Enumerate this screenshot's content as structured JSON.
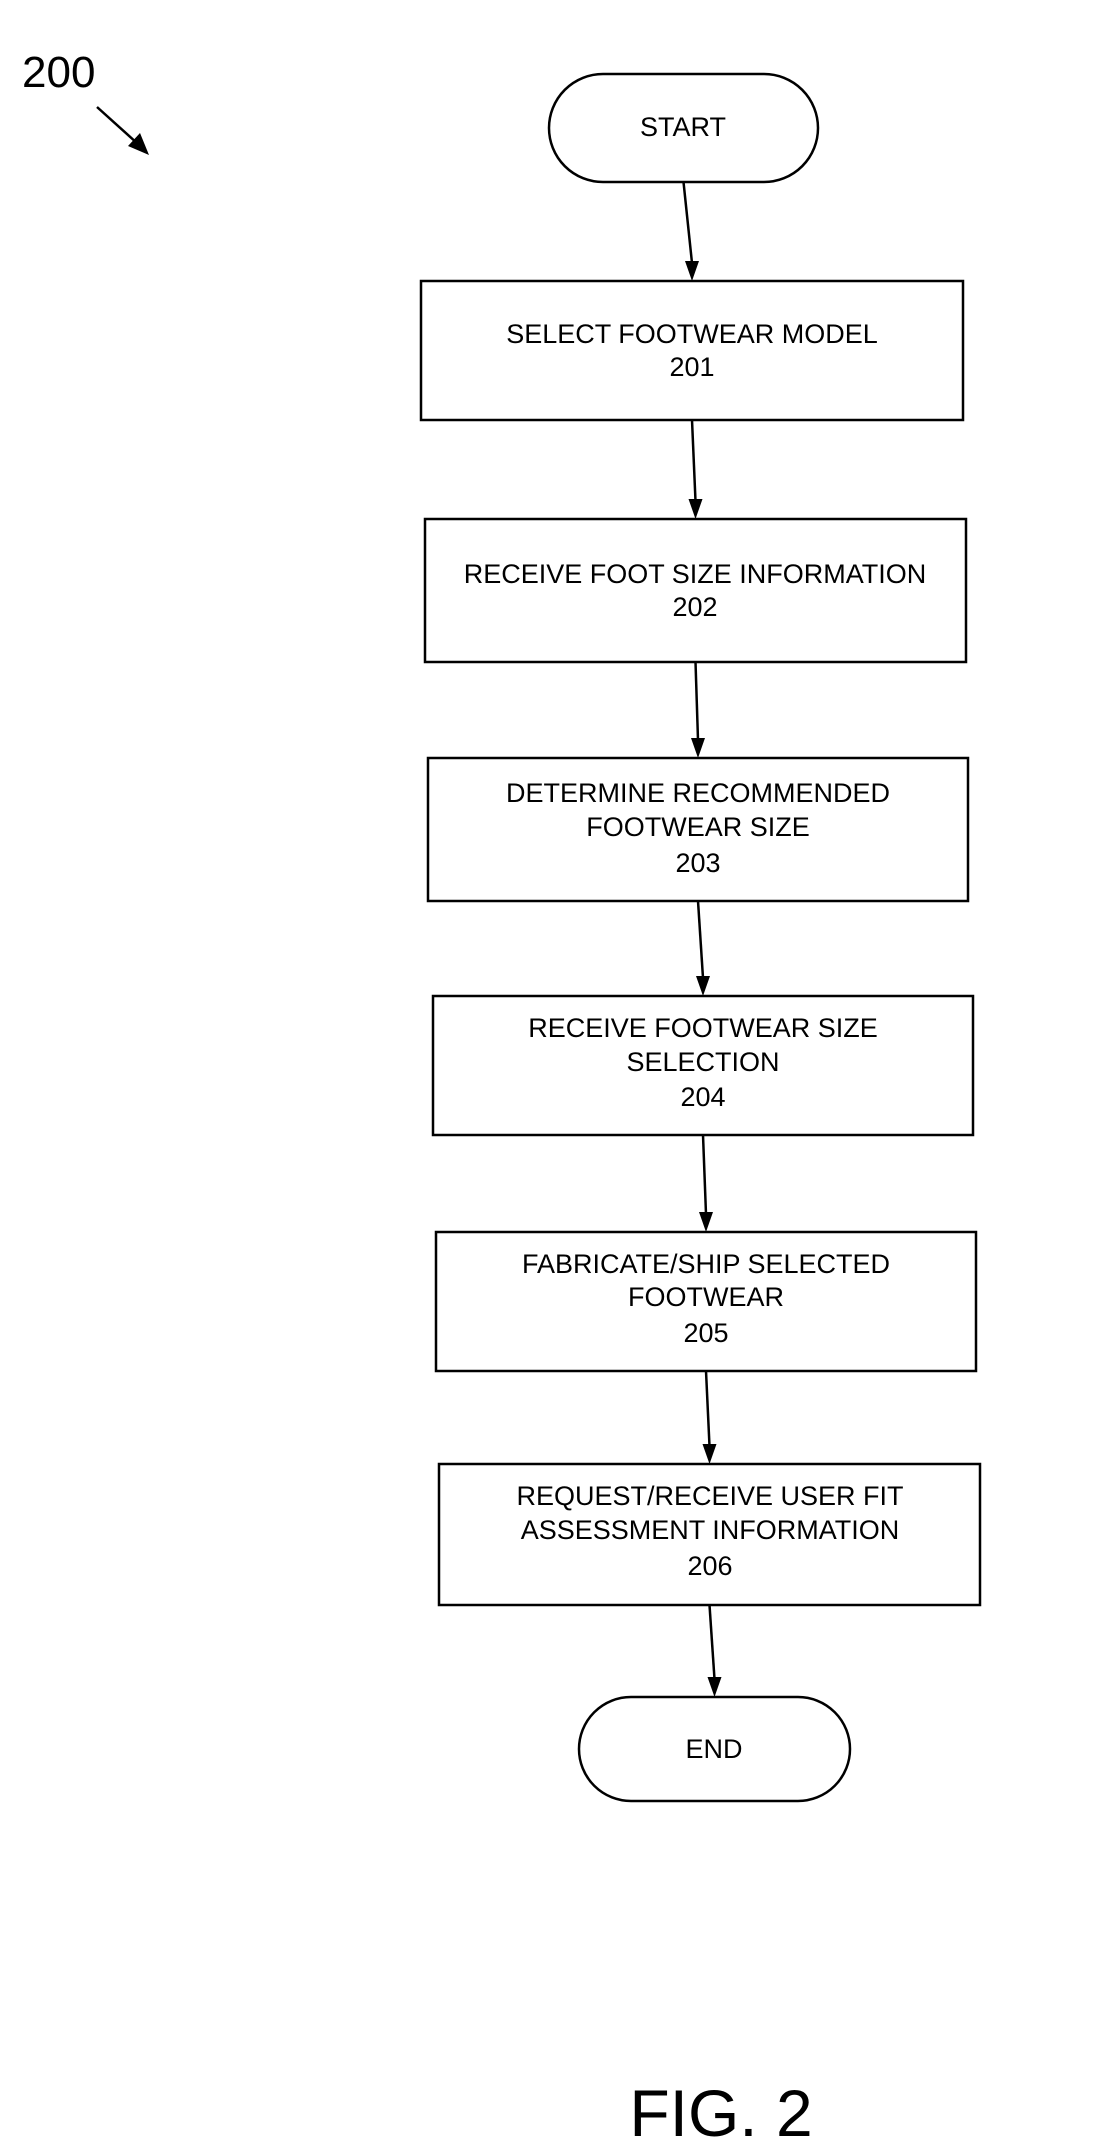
{
  "figure": {
    "reference_numeral": "200",
    "caption": "FIG. 2",
    "ink_color": "#000000",
    "background_color": "#ffffff"
  },
  "flow": {
    "start": {
      "label": "START"
    },
    "steps": [
      {
        "id": "201",
        "lines": [
          "SELECT FOOTWEAR MODEL"
        ],
        "number": "201"
      },
      {
        "id": "202",
        "lines": [
          "RECEIVE FOOT SIZE INFORMATION"
        ],
        "number": "202"
      },
      {
        "id": "203",
        "lines": [
          "DETERMINE RECOMMENDED",
          "FOOTWEAR SIZE"
        ],
        "number": "203"
      },
      {
        "id": "204",
        "lines": [
          "RECEIVE FOOTWEAR SIZE",
          "SELECTION"
        ],
        "number": "204"
      },
      {
        "id": "205",
        "lines": [
          "FABRICATE/SHIP SELECTED",
          "FOOTWEAR"
        ],
        "number": "205"
      },
      {
        "id": "206",
        "lines": [
          "REQUEST/RECEIVE USER FIT",
          "ASSESSMENT INFORMATION"
        ],
        "number": "206"
      }
    ],
    "end": {
      "label": "END"
    },
    "connections": [
      {
        "from": "start",
        "to": "201"
      },
      {
        "from": "201",
        "to": "202"
      },
      {
        "from": "202",
        "to": "203"
      },
      {
        "from": "203",
        "to": "204"
      },
      {
        "from": "204",
        "to": "205"
      },
      {
        "from": "205",
        "to": "206"
      },
      {
        "from": "206",
        "to": "end"
      }
    ]
  }
}
